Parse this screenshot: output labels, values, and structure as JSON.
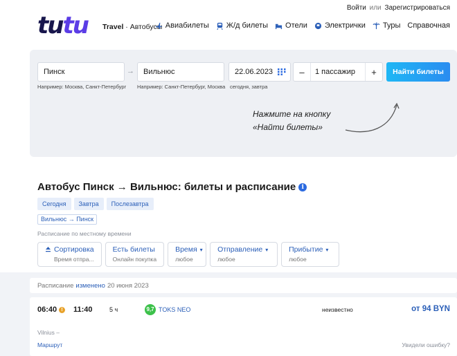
{
  "auth": {
    "login": "Войти",
    "or": "или",
    "register": "Зарегистрироваться"
  },
  "brand": {
    "logo_part1": "tu",
    "logo_part2": "tu",
    "section_bold": "Travel",
    "section_rest": " · Автобусы"
  },
  "nav": [
    {
      "label": "Авиабилеты",
      "icon": "plane-icon"
    },
    {
      "label": "Ж/д билеты",
      "icon": "train-icon"
    },
    {
      "label": "Отели",
      "icon": "hotel-icon"
    },
    {
      "label": "Электрички",
      "icon": "commuter-train-icon"
    },
    {
      "label": "Туры",
      "icon": "palm-icon"
    },
    {
      "label": "Справочная",
      "icon": ""
    }
  ],
  "search": {
    "from_value": "Пинск",
    "from_hint": "Например: Москва, Санкт-Петербург",
    "to_value": "Вильнюс",
    "to_hint": "Например: Санкт-Петербург, Москва",
    "date_value": "22.06.2023",
    "date_hint": "сегодня, завтра",
    "passengers": "1 пассажир",
    "minus": "–",
    "plus": "+",
    "submit_label": "Найти билеты",
    "swap_glyph": "→"
  },
  "callout": {
    "line1": "Нажмите на кнопку",
    "line2": "«Найти билеты»"
  },
  "page": {
    "title": "Автобус Пинск → Вильнюс: билеты и расписание",
    "info_glyph": "i",
    "day_tabs": [
      "Сегодня",
      "Завтра",
      "Послезавтра"
    ],
    "reverse_route": "Вильнюс → Пинск",
    "tz_note": "Расписание по местному времени"
  },
  "filters": [
    {
      "title": "Сортировка",
      "sub": "Время отпра...",
      "icon": "sort-icon"
    },
    {
      "title": "Есть билеты",
      "sub": "Онлайн покупка"
    },
    {
      "title": "Время",
      "sub": "любое"
    },
    {
      "title": "Отправление",
      "sub": "любое"
    },
    {
      "title": "Прибытие",
      "sub": "любое"
    }
  ],
  "schedule": {
    "prefix": "Расписание",
    "changed": "изменено",
    "date": "20 июня 2023"
  },
  "trip": {
    "departure": "06:40",
    "warn_glyph": "!",
    "arrival": "11:40",
    "duration": "5 ч",
    "rating": "9,7",
    "carrier": "TOKS NEO",
    "availability": "неизвестно",
    "price": "от 94 BYN",
    "stop": "Vilnius –",
    "route_link": "Маршрут",
    "report": "Увидели ошибку?"
  },
  "colors": {
    "brand_dark": "#18164c",
    "brand_purple": "#5b3de6",
    "link": "#2b5fb8",
    "button_start": "#1fb7f5",
    "button_end": "#2a8cf0",
    "rating_green": "#3cc14a"
  }
}
